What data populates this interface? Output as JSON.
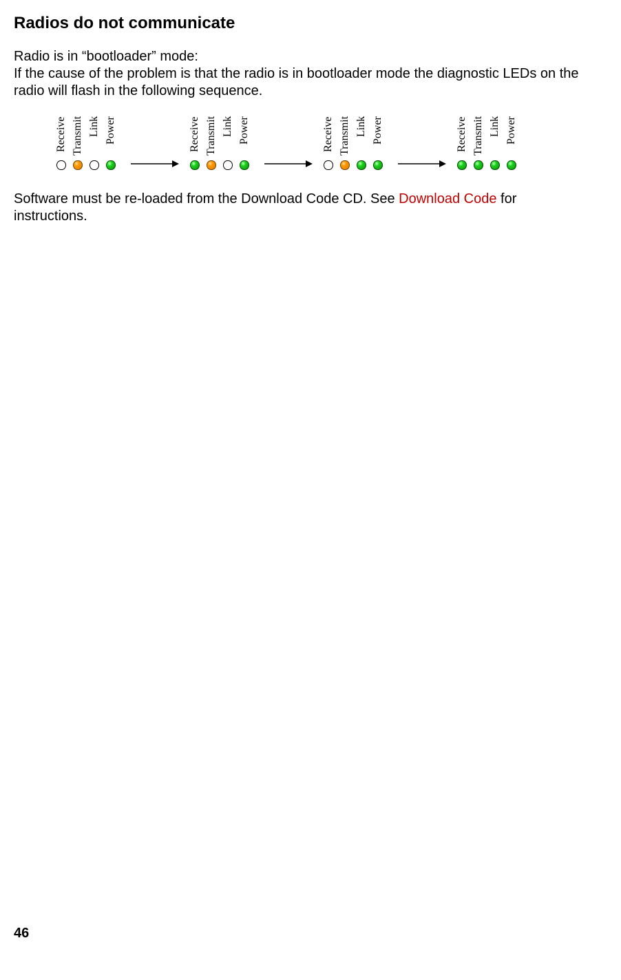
{
  "heading": "Radios do not communicate",
  "body_line1": "Radio is in “bootloader” mode:",
  "body_line2": "If the cause of the problem is that the radio is in bootloader mode the diagnostic LEDs on the radio will flash in the following sequence.",
  "led_labels": {
    "receive": "Receive",
    "transmit": "Transmit",
    "link": "Link",
    "power": "Power"
  },
  "sequence": [
    {
      "receive": "off",
      "transmit": "orange",
      "link": "off",
      "power": "green"
    },
    {
      "receive": "green",
      "transmit": "orange",
      "link": "off",
      "power": "green"
    },
    {
      "receive": "off",
      "transmit": "orange",
      "link": "green",
      "power": "green"
    },
    {
      "receive": "green",
      "transmit": "green",
      "link": "green",
      "power": "green"
    }
  ],
  "instruction": {
    "before": "  Software must be re-loaded from the Download Code CD.  See  ",
    "link_text": "Download Code",
    "after": " for instructions."
  },
  "page_number": "46"
}
